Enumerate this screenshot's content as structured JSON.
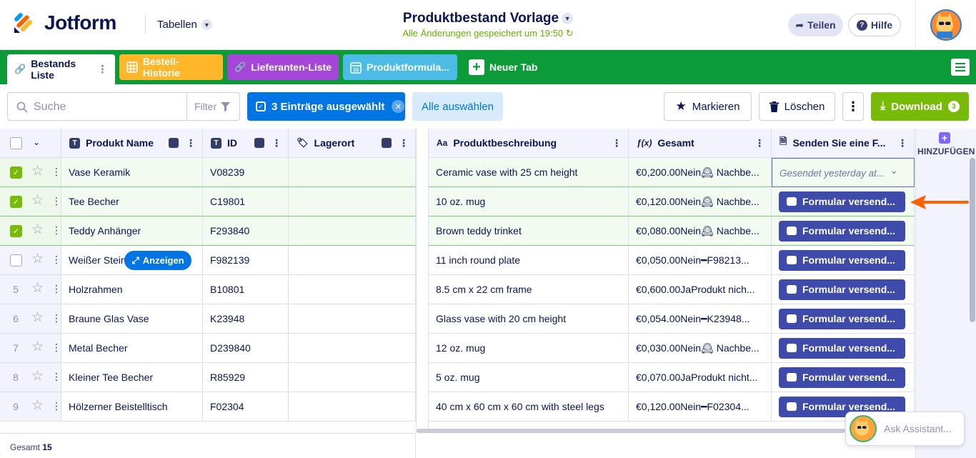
{
  "header": {
    "brand": "Jotform",
    "section": "Tabellen",
    "title": "Produktbestand Vorlage",
    "saved_status": "Alle Änderungen gespeichert um 19:50",
    "share_label": "Teilen",
    "help_label": "Hilfe"
  },
  "tabs": [
    {
      "label": "Bestands Liste",
      "color": "#ffffff",
      "icon": "link-icon",
      "active": true
    },
    {
      "label": "Bestell-Historie",
      "color": "#ffb629",
      "icon": "table-icon"
    },
    {
      "label": "Lieferanten-Liste",
      "color": "#a646d8",
      "icon": "link-icon"
    },
    {
      "label": "Produktformula...",
      "color": "#4cbbe5",
      "icon": "calendar-icon"
    },
    {
      "label": "Neuer Tab",
      "icon": "plus-icon"
    }
  ],
  "toolbar": {
    "search_placeholder": "Suche",
    "filter_label": "Filter",
    "selected_label": "3 Einträge ausgewählt",
    "select_all_label": "Alle auswählen",
    "mark_label": "Markieren",
    "delete_label": "Löschen",
    "download_label": "Download",
    "download_count": "3"
  },
  "columns": [
    {
      "label": "Produkt Name",
      "icon": "T"
    },
    {
      "label": "ID",
      "icon": "T"
    },
    {
      "label": "Lagerort",
      "icon": "tag-icon"
    },
    {
      "label": "Produktbeschreibung",
      "icon": "Aa"
    },
    {
      "label": "Gesamt",
      "icon": "fx"
    },
    {
      "label": "Senden Sie eine F...",
      "icon": "form-icon"
    }
  ],
  "add_column_label": "HINZUFÜGEN",
  "rows": [
    {
      "num": "",
      "selected": true,
      "name": "Vase Keramik",
      "id": "V08239",
      "desc": "Ceramic vase with 25 cm height",
      "total": "€0,200.00Nein🕰 Nachbe...",
      "form": "Gesendet yesterday at...",
      "sent": true
    },
    {
      "num": "",
      "selected": true,
      "name": "Tee Becher",
      "id": "C19801",
      "desc": "10 oz. mug",
      "total": "€0,120.00Nein🕰 Nachbe...",
      "form": "Formular versend..."
    },
    {
      "num": "",
      "selected": true,
      "name": "Teddy Anhänger",
      "id": "F293840",
      "desc": "Brown teddy trinket",
      "total": "€0,080.00Nein🕰 Nachbe...",
      "form": "Formular versend..."
    },
    {
      "num": "",
      "selected": false,
      "name": "Weißer Stein",
      "id": "F982139",
      "desc": "11 inch round plate",
      "total": "€0,050.00Nein━F98213...",
      "form": "Formular versend..."
    },
    {
      "num": "5",
      "selected": false,
      "name": "Holzrahmen",
      "id": "B10801",
      "desc": "8.5 cm x 22 cm frame",
      "total": "€0,600.00JaProdukt nich...",
      "form": "Formular versend..."
    },
    {
      "num": "6",
      "selected": false,
      "name": "Braune Glas Vase",
      "id": "K23948",
      "desc": "Glass vase with 20 cm height",
      "total": "€0,054.00Nein━K23948...",
      "form": "Formular versend..."
    },
    {
      "num": "7",
      "selected": false,
      "name": "Metal Becher",
      "id": "D239840",
      "desc": "12 oz. mug",
      "total": "€0,030.00Nein🕰 Nachbe...",
      "form": "Formular versend..."
    },
    {
      "num": "8",
      "selected": false,
      "name": "Kleiner Tee Becher",
      "id": "R85929",
      "desc": "5 oz. mug",
      "total": "€0,070.00JaProdukt nicht...",
      "form": "Formular versend..."
    },
    {
      "num": "9",
      "selected": false,
      "name": "Hölzerner Beistelltisch",
      "id": "F02304",
      "desc": "40 cm x 60 cm x 60 cm with steel legs",
      "total": "€0,120.00Nein━F02304...",
      "form": "Formular versend..."
    }
  ],
  "hover_action_label": "Anzeigen",
  "footer": {
    "label": "Gesamt",
    "count": "15"
  },
  "assistant_placeholder": "Ask Assistant...",
  "colors": {
    "green": "#0d9b3a",
    "blue": "#0075e3",
    "form_button": "#3e4bab",
    "download": "#78bb07",
    "arrow": "#ff6100"
  }
}
